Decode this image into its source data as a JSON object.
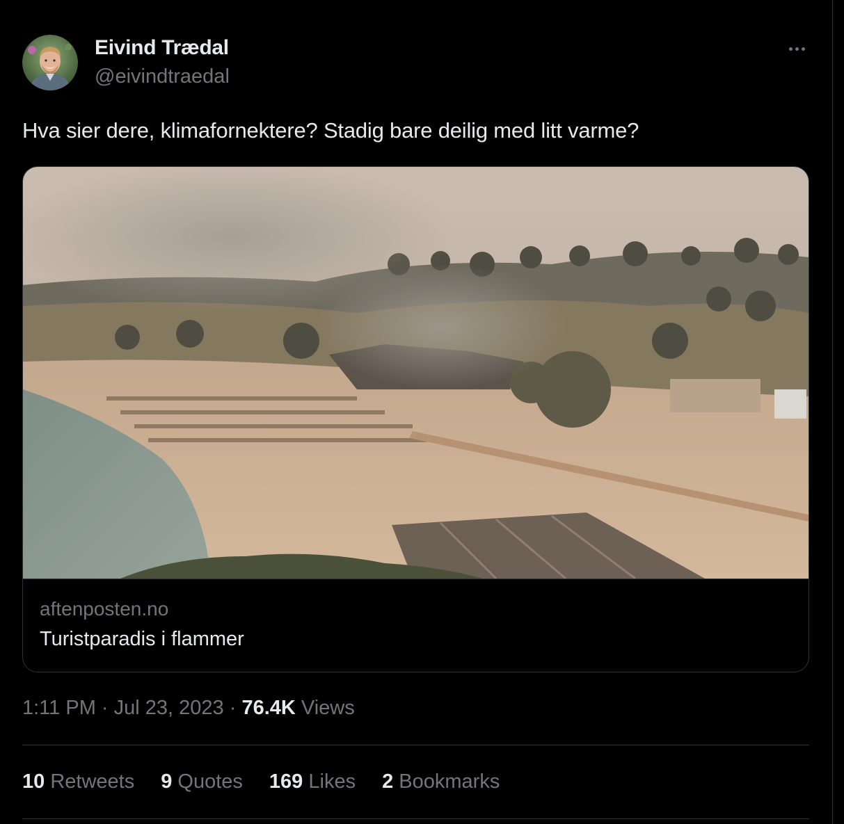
{
  "author": {
    "name": "Eivind Trædal",
    "handle": "@eivindtraedal",
    "avatar_icon": "profile-photo"
  },
  "more_icon": "ellipsis-icon",
  "tweet": {
    "text": "Hva sier dere, klimafornektere? Stadig bare deilig med litt varme?"
  },
  "card": {
    "image_description_icon": "wildfire-beach-photo",
    "domain": "aftenposten.no",
    "title": "Turistparadis i flammer"
  },
  "meta": {
    "time": "1:11 PM",
    "separator": " · ",
    "date": "Jul 23, 2023",
    "views_count": "76.4K",
    "views_label": "Views"
  },
  "stats": [
    {
      "count": "10",
      "label": "Retweets"
    },
    {
      "count": "9",
      "label": "Quotes"
    },
    {
      "count": "169",
      "label": "Likes"
    },
    {
      "count": "2",
      "label": "Bookmarks"
    }
  ],
  "colors": {
    "background": "#000000",
    "text_primary": "#e7e9ea",
    "text_secondary": "#71767b",
    "border": "#2f3336"
  }
}
